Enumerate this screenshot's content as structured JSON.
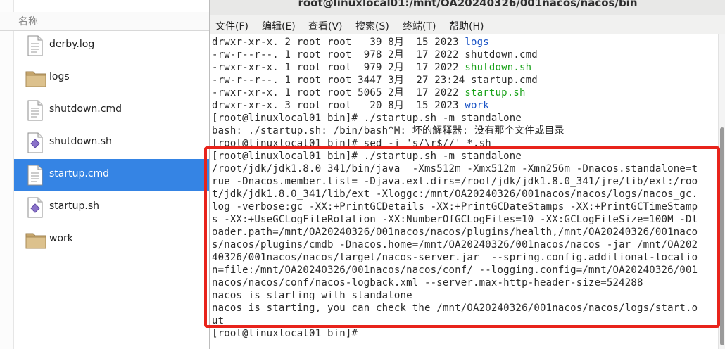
{
  "file_manager": {
    "column_header": "名称",
    "files": [
      {
        "name": "derby.log",
        "icon": "text-file-icon",
        "selected": false
      },
      {
        "name": "logs",
        "icon": "folder-icon",
        "selected": false
      },
      {
        "name": "shutdown.cmd",
        "icon": "text-file-icon",
        "selected": false
      },
      {
        "name": "shutdown.sh",
        "icon": "script-file-icon",
        "selected": false
      },
      {
        "name": "startup.cmd",
        "icon": "text-file-icon",
        "selected": true
      },
      {
        "name": "startup.sh",
        "icon": "script-file-icon",
        "selected": false
      },
      {
        "name": "work",
        "icon": "folder-icon",
        "selected": false
      }
    ]
  },
  "terminal": {
    "title": "root@linuxlocal01:/mnt/OA20240326/001nacos/nacos/bin",
    "menu": [
      "文件(F)",
      "编辑(E)",
      "查看(V)",
      "搜索(S)",
      "终端(T)",
      "帮助(H)"
    ],
    "lines": [
      {
        "pre": "drwxr-xr-x. 2 root root   39 8月  15 2023 ",
        "name": "logs",
        "cls": "blue"
      },
      {
        "pre": "-rw-r--r--. 1 root root  978 2月  17 2022 ",
        "name": "shutdown.cmd",
        "cls": ""
      },
      {
        "pre": "-rwxr-xr-x. 1 root root  979 2月  17 2022 ",
        "name": "shutdown.sh",
        "cls": "green"
      },
      {
        "pre": "-rw-r--r--. 1 root root 3447 3月  27 23:24 ",
        "name": "startup.cmd",
        "cls": ""
      },
      {
        "pre": "-rwxr-xr-x. 1 root root 5065 2月  17 2022 ",
        "name": "startup.sh",
        "cls": "green"
      },
      {
        "pre": "drwxr-xr-x. 3 root root   20 8月  15 2023 ",
        "name": "work",
        "cls": "blue"
      },
      {
        "pre": "[root@linuxlocal01 bin]# ./startup.sh -m standalone",
        "name": "",
        "cls": ""
      },
      {
        "pre": "bash: ./startup.sh: /bin/bash^M: 坏的解释器: 没有那个文件或目录",
        "name": "",
        "cls": ""
      },
      {
        "pre": "[root@linuxlocal01 bin]# sed -i 's/\\r$//' *.sh",
        "name": "",
        "cls": ""
      },
      {
        "pre": "[root@linuxlocal01 bin]# ./startup.sh -m standalone",
        "name": "",
        "cls": ""
      },
      {
        "pre": "/root/jdk/jdk1.8.0_341/bin/java  -Xms512m -Xmx512m -Xmn256m -Dnacos.standalone=t",
        "name": "",
        "cls": ""
      },
      {
        "pre": "rue -Dnacos.member.list= -Djava.ext.dirs=/root/jdk/jdk1.8.0_341/jre/lib/ext:/roo",
        "name": "",
        "cls": ""
      },
      {
        "pre": "t/jdk/jdk1.8.0_341/lib/ext -Xloggc:/mnt/OA20240326/001nacos/nacos/logs/nacos_gc.",
        "name": "",
        "cls": ""
      },
      {
        "pre": "log -verbose:gc -XX:+PrintGCDetails -XX:+PrintGCDateStamps -XX:+PrintGCTimeStamp",
        "name": "",
        "cls": ""
      },
      {
        "pre": "s -XX:+UseGCLogFileRotation -XX:NumberOfGCLogFiles=10 -XX:GCLogFileSize=100M -Dl",
        "name": "",
        "cls": ""
      },
      {
        "pre": "oader.path=/mnt/OA20240326/001nacos/nacos/plugins/health,/mnt/OA20240326/001naco",
        "name": "",
        "cls": ""
      },
      {
        "pre": "s/nacos/plugins/cmdb -Dnacos.home=/mnt/OA20240326/001nacos/nacos -jar /mnt/OA202",
        "name": "",
        "cls": ""
      },
      {
        "pre": "40326/001nacos/nacos/target/nacos-server.jar  --spring.config.additional-locatio",
        "name": "",
        "cls": ""
      },
      {
        "pre": "n=file:/mnt/OA20240326/001nacos/nacos/conf/ --logging.config=/mnt/OA20240326/001",
        "name": "",
        "cls": ""
      },
      {
        "pre": "nacos/nacos/conf/nacos-logback.xml --server.max-http-header-size=524288",
        "name": "",
        "cls": ""
      },
      {
        "pre": "nacos is starting with standalone",
        "name": "",
        "cls": ""
      },
      {
        "pre": "nacos is starting, you can check the /mnt/OA20240326/001nacos/nacos/logs/start.o",
        "name": "",
        "cls": ""
      },
      {
        "pre": "ut",
        "name": "",
        "cls": ""
      },
      {
        "pre": "[root@linuxlocal01 bin]# ",
        "name": "",
        "cls": ""
      }
    ]
  },
  "colors": {
    "selection": "#3584e4",
    "dir_blue": "#1a54c6",
    "exec_green": "#1aa21a",
    "highlight_red": "#e8231b"
  }
}
